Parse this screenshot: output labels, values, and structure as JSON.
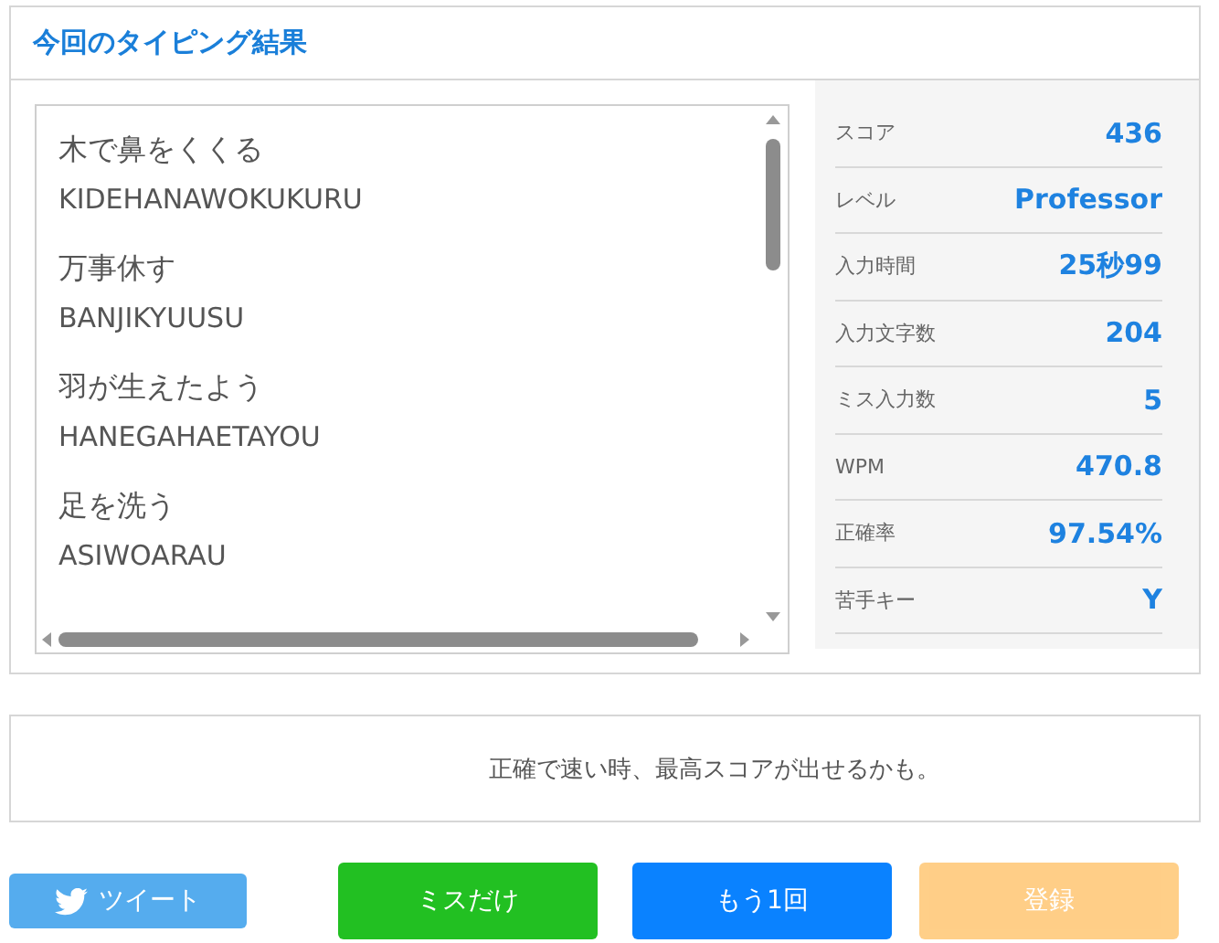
{
  "panel": {
    "title": "今回のタイピング結果"
  },
  "words": [
    {
      "text": "木で鼻をくくる",
      "romaji": "KIDEHANAWOKUKURU"
    },
    {
      "text": "万事休す",
      "romaji": "BANJIKYUUSU"
    },
    {
      "text": "羽が生えたよう",
      "romaji": "HANEGAHAETAYOU"
    },
    {
      "text": "足を洗う",
      "romaji": "ASIWOARAU"
    }
  ],
  "stats": [
    {
      "label": "スコア",
      "value": "436"
    },
    {
      "label": "レベル",
      "value": "Professor"
    },
    {
      "label": "入力時間",
      "value": "25秒99"
    },
    {
      "label": "入力文字数",
      "value": "204"
    },
    {
      "label": "ミス入力数",
      "value": "5"
    },
    {
      "label": "WPM",
      "value": "470.8"
    },
    {
      "label": "正確率",
      "value": "97.54%"
    },
    {
      "label": "苦手キー",
      "value": "Y"
    }
  ],
  "hint": "正確で速い時、最高スコアが出せるかも。",
  "buttons": [
    {
      "kind": "tweet",
      "label": "ツイート",
      "disabled": false
    },
    {
      "kind": "green",
      "label": "ミスだけ",
      "disabled": false
    },
    {
      "kind": "blue",
      "label": "もう1回",
      "disabled": false
    },
    {
      "kind": "orange",
      "label": "登録",
      "disabled": true
    }
  ]
}
